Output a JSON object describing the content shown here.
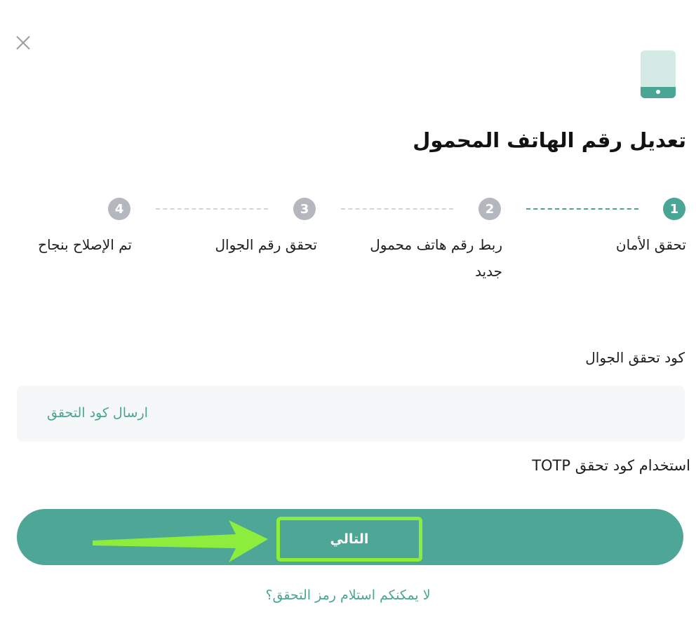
{
  "icons": {
    "close": "close-icon",
    "phone": "mobile-phone-icon",
    "arrow": "arrow-right-icon"
  },
  "title": "تعديل رقم الهاتف المحمول",
  "steps": [
    {
      "number": "1",
      "label": "تحقق الأمان",
      "active": true
    },
    {
      "number": "2",
      "label": "ربط رقم هاتف محمول جديد",
      "active": false
    },
    {
      "number": "3",
      "label": "تحقق رقم الجوال",
      "active": false
    },
    {
      "number": "4",
      "label": "تم الإصلاح بنجاح",
      "active": false
    }
  ],
  "form": {
    "code_label": "كود تحقق الجوال",
    "send_code": "ارسال كود التحقق",
    "totp_link": "استخدام كود تحقق TOTP"
  },
  "actions": {
    "next": "التالي",
    "cant_receive": "لا يمكنكم استلام رمز التحقق؟"
  },
  "colors": {
    "accent": "#4ba594",
    "button": "#4ea796",
    "inactive_step": "#b4b7bd",
    "highlight": "#8ded3c"
  }
}
